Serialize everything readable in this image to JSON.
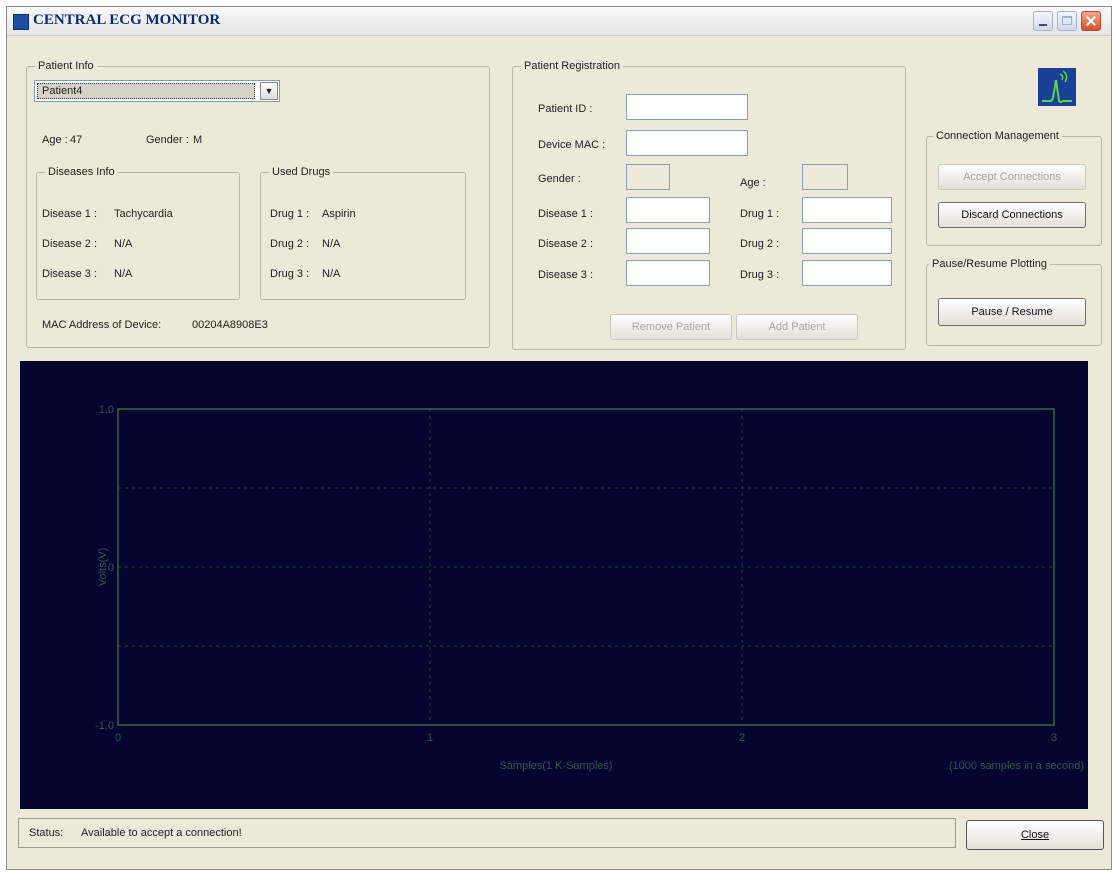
{
  "window": {
    "title": "CENTRAL ECG MONITOR"
  },
  "patient_info": {
    "legend": "Patient Info",
    "selected_patient": "Patient4",
    "age_label": "Age :",
    "age": "47",
    "gender_label": "Gender :",
    "gender": "M",
    "diseases": {
      "legend": "Diseases Info",
      "items": [
        {
          "label": "Disease 1 :",
          "value": "Tachycardia"
        },
        {
          "label": "Disease 2 :",
          "value": "N/A"
        },
        {
          "label": "Disease 3 :",
          "value": "N/A"
        }
      ]
    },
    "drugs": {
      "legend": "Used Drugs",
      "items": [
        {
          "label": "Drug 1 :",
          "value": "Aspirin"
        },
        {
          "label": "Drug 2 :",
          "value": "N/A"
        },
        {
          "label": "Drug 3 :",
          "value": "N/A"
        }
      ]
    },
    "mac_label": "MAC Address of Device:",
    "mac_value": "00204A8908E3"
  },
  "registration": {
    "legend": "Patient Registration",
    "patient_id_label": "Patient ID :",
    "device_mac_label": "Device MAC :",
    "gender_label": "Gender :",
    "age_label": "Age :",
    "disease_labels": [
      "Disease 1 :",
      "Disease 2 :",
      "Disease 3 :"
    ],
    "drug_labels": [
      "Drug 1 :",
      "Drug 2 :",
      "Drug 3 :"
    ],
    "values": {
      "patient_id": "",
      "device_mac": "",
      "gender": "",
      "age": "",
      "disease1": "",
      "disease2": "",
      "disease3": "",
      "drug1": "",
      "drug2": "",
      "drug3": ""
    },
    "remove_button": "Remove Patient",
    "add_button": "Add Patient"
  },
  "connection": {
    "legend": "Connection Management",
    "accept_button": "Accept Connections",
    "discard_button": "Discard Connections"
  },
  "plotting": {
    "legend": "Pause/Resume Plotting",
    "pause_button": "Pause / Resume"
  },
  "chart_data": {
    "type": "line",
    "xlabel": "Samples(1 K-Samples)",
    "ylabel": "Volts(V)",
    "annotation": "(1000 samples in a second)",
    "xlim": [
      0,
      3
    ],
    "ylim": [
      -1,
      1
    ],
    "x_ticks": [
      "0",
      "1",
      "2",
      "3"
    ],
    "y_ticks": [
      "1.0",
      "0",
      "-1.0"
    ],
    "grid": true,
    "series": [],
    "colors": {
      "background": "#04042e",
      "frame": "#2e6a3f",
      "grid": "#1f3f3a",
      "text": "#2a5a52"
    }
  },
  "status": {
    "label": "Status:",
    "text": "Available to accept a connection!"
  },
  "close_button": "Close"
}
